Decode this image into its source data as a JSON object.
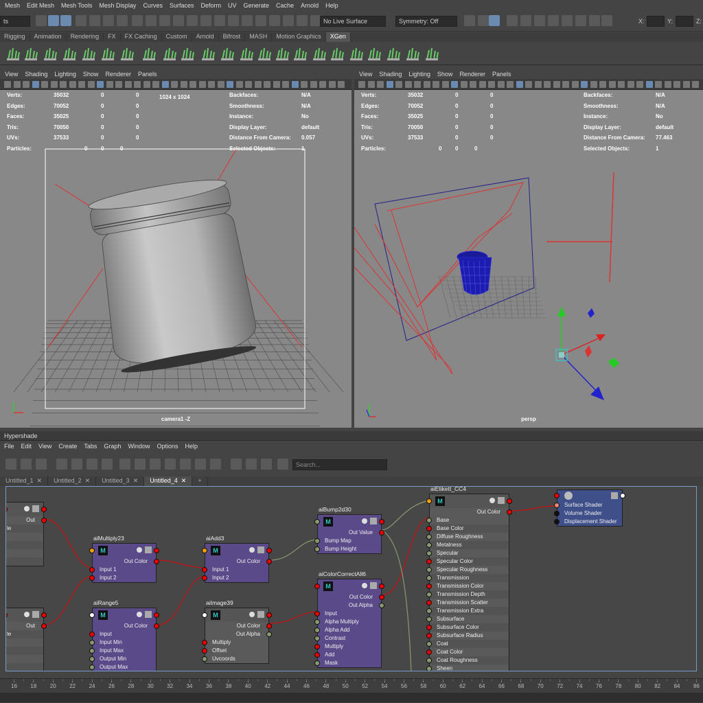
{
  "menubar": [
    "Mesh",
    "Edit Mesh",
    "Mesh Tools",
    "Mesh Display",
    "Curves",
    "Surfaces",
    "Deform",
    "UV",
    "Generate",
    "Cache",
    "Arnold",
    "Help"
  ],
  "statusline": {
    "left_field": "ts",
    "live_surface": "No Live Surface",
    "symmetry": "Symmetry: Off",
    "x_label": "X:",
    "y_label": "Y:",
    "z_label": "Z:"
  },
  "shelf_tabs": [
    "Rigging",
    "Animation",
    "Rendering",
    "FX",
    "FX Caching",
    "Custom",
    "Arnold",
    "Bifrost",
    "MASH",
    "Motion Graphics",
    "XGen"
  ],
  "shelf_active": "XGen",
  "viewport_menu": [
    "View",
    "Shading",
    "Lighting",
    "Show",
    "Renderer",
    "Panels"
  ],
  "left_viewport": {
    "camera_label": "camera1 -Z",
    "resolution": "1024 x 1024",
    "stats": [
      {
        "label": "Verts:",
        "a": "35032",
        "b": "0",
        "c": "0"
      },
      {
        "label": "Edges:",
        "a": "70052",
        "b": "0",
        "c": "0"
      },
      {
        "label": "Faces:",
        "a": "35025",
        "b": "0",
        "c": "0"
      },
      {
        "label": "Tris:",
        "a": "70050",
        "b": "0",
        "c": "0"
      },
      {
        "label": "UVs:",
        "a": "37533",
        "b": "0",
        "c": "0"
      },
      {
        "label": "Particles:",
        "a": "0",
        "b": "0",
        "c": "0"
      }
    ],
    "info": [
      {
        "label": "Backfaces:",
        "value": "N/A"
      },
      {
        "label": "Smoothness:",
        "value": "N/A"
      },
      {
        "label": "Instance:",
        "value": "No"
      },
      {
        "label": "Display Layer:",
        "value": "default"
      },
      {
        "label": "Distance From Camera:",
        "value": "0.057"
      },
      {
        "label": "Selected Objects:",
        "value": "1"
      }
    ]
  },
  "right_viewport": {
    "camera_label": "persp",
    "stats": [
      {
        "label": "Verts:",
        "a": "35032",
        "b": "0",
        "c": "0"
      },
      {
        "label": "Edges:",
        "a": "70052",
        "b": "0",
        "c": "0"
      },
      {
        "label": "Faces:",
        "a": "35025",
        "b": "0",
        "c": "0"
      },
      {
        "label": "Tris:",
        "a": "70050",
        "b": "0",
        "c": "0"
      },
      {
        "label": "UVs:",
        "a": "37533",
        "b": "0",
        "c": "0"
      },
      {
        "label": "Particles:",
        "a": "0",
        "b": "0",
        "c": "0"
      }
    ],
    "info": [
      {
        "label": "Backfaces:",
        "value": "N/A"
      },
      {
        "label": "Smoothness:",
        "value": "N/A"
      },
      {
        "label": "Instance:",
        "value": "No"
      },
      {
        "label": "Display Layer:",
        "value": "default"
      },
      {
        "label": "Distance From Camera:",
        "value": "77.463"
      },
      {
        "label": "Selected Objects:",
        "value": "1"
      }
    ]
  },
  "hypershade": {
    "title": "Hypershade",
    "menu": [
      "File",
      "Edit",
      "View",
      "Create",
      "Tabs",
      "Graph",
      "Window",
      "Options",
      "Help"
    ],
    "search_placeholder": "Search...",
    "tabs": [
      {
        "label": "Untitled_1",
        "close": "✕",
        "active": false
      },
      {
        "label": "Untitled_2",
        "close": "✕",
        "active": false
      },
      {
        "label": "Untitled_3",
        "close": "✕",
        "active": false
      },
      {
        "label": "Untitled_4",
        "close": "✕",
        "active": true
      },
      {
        "label": "+",
        "close": "",
        "active": false
      }
    ],
    "nodes": {
      "left1": {
        "rows": [
          "Out Color",
          "le",
          "",
          "",
          "",
          ""
        ]
      },
      "left2": {
        "rows": [
          "Out Color",
          "le",
          "",
          "",
          "",
          ""
        ]
      },
      "aiMultiply23": {
        "title": "aiMultiply23",
        "out": "Out Color",
        "inputs": [
          "Input 1",
          "Input 2"
        ]
      },
      "aiAdd3": {
        "title": "aiAdd3",
        "out": "Out Color",
        "inputs": [
          "Input 1",
          "Input 2"
        ]
      },
      "aiRange5": {
        "title": "aiRange5",
        "out": "Out Color",
        "inputs": [
          "Input",
          "Input Min",
          "Input Max",
          "Output Min",
          "Output Max"
        ]
      },
      "aiImage39": {
        "title": "aiImage39",
        "outs": [
          "Out Color",
          "Out Alpha"
        ],
        "inputs": [
          "Multiply",
          "Offset",
          "Uvcoords"
        ]
      },
      "aiBump2d30": {
        "title": "aiBump2d30",
        "out": "Out Value",
        "inputs": [
          "Bump Map",
          "Bump Height"
        ]
      },
      "aiColorCorrectAll6": {
        "title": "aiColorCorrectAll6",
        "outs": [
          "Out Color",
          "Out Alpha"
        ],
        "inputs": [
          "Input",
          "Alpha Multiply",
          "Alpha Add",
          "Contrast",
          "Multiply",
          "Add",
          "Mask"
        ]
      },
      "aiEtikett_CC4": {
        "title": "aiEtikett_CC4",
        "out": "Out Color",
        "inputs": [
          "Base",
          "Base Color",
          "Diffuse Roughness",
          "Metalness",
          "Specular",
          "Specular Color",
          "Specular Roughness",
          "Transmission",
          "Transmission Color",
          "Transmission Depth",
          "Transmission Scatter",
          "Transmission Extra Roughness",
          "Subsurface",
          "Subsurface Color",
          "Subsurface Radius",
          "Coat",
          "Coat Color",
          "Coat Roughness",
          "Sheen"
        ]
      },
      "shadingGroup": {
        "inputs": [
          "Surface Shader",
          "Volume Shader",
          "Displacement Shader"
        ]
      }
    }
  },
  "timeline": {
    "ticks": [
      "16",
      "18",
      "20",
      "22",
      "24",
      "26",
      "28",
      "30",
      "32",
      "34",
      "36",
      "38",
      "40",
      "42",
      "44",
      "46",
      "48",
      "50",
      "52",
      "54",
      "56",
      "58",
      "60",
      "62",
      "64",
      "66",
      "68",
      "70",
      "72",
      "74",
      "76",
      "78",
      "80",
      "82",
      "84",
      "86"
    ]
  },
  "colors": {
    "accent": "#7a9cc6",
    "node_purple": "#5a4a8a",
    "port_red": "#e00",
    "port_orange": "#f2a000",
    "shading_group_blue": "#3e4f8a"
  }
}
